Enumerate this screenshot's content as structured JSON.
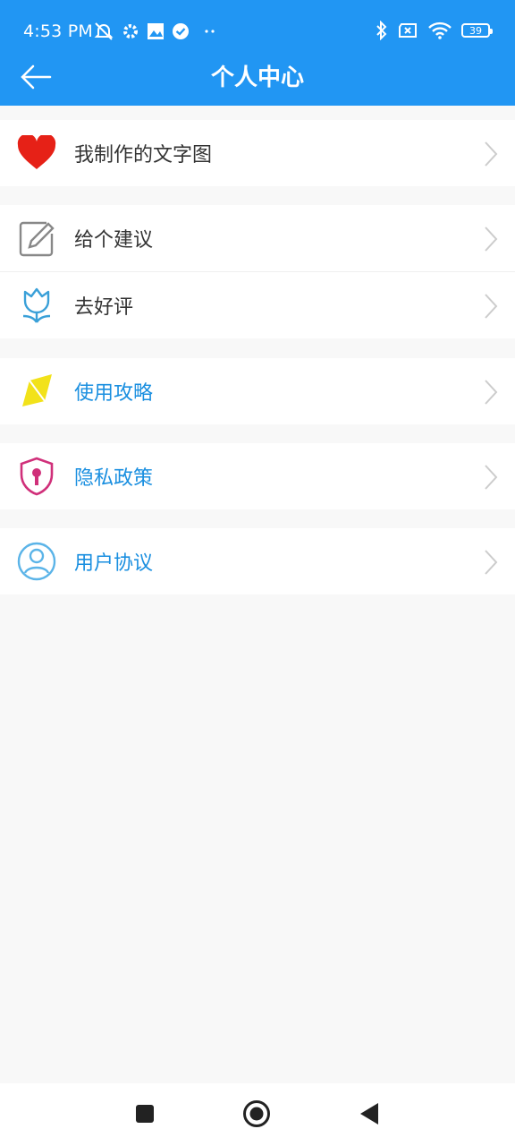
{
  "status_bar": {
    "time": "4:53 PM",
    "battery": "39",
    "left_icons": [
      "mute-icon",
      "gear-icon",
      "gallery-icon",
      "check-circle-icon",
      "more-dots-icon"
    ],
    "right_icons": [
      "bluetooth-icon",
      "sim-off-icon",
      "wifi-icon",
      "battery-icon"
    ]
  },
  "header": {
    "title": "个人中心",
    "back_icon": "arrow-left-icon"
  },
  "menu": {
    "my_text_images": {
      "label": "我制作的文字图",
      "icon": "heart-icon"
    },
    "feedback": {
      "label": "给个建议",
      "icon": "edit-icon"
    },
    "rate": {
      "label": "去好评",
      "icon": "tulip-icon"
    },
    "guide": {
      "label": "使用攻略",
      "icon": "kite-icon"
    },
    "privacy": {
      "label": "隐私政策",
      "icon": "shield-lock-icon"
    },
    "agreement": {
      "label": "用户协议",
      "icon": "user-circle-icon"
    }
  },
  "colors": {
    "primary": "#2196f3",
    "link_blue": "#1a8fe0",
    "text": "#333333",
    "background": "#f8f8f8",
    "heart": "#e62117",
    "kite": "#f2e21a",
    "shield": "#d0307a"
  },
  "nav_bar": [
    "recents-square-icon",
    "home-circle-icon",
    "back-triangle-icon"
  ]
}
